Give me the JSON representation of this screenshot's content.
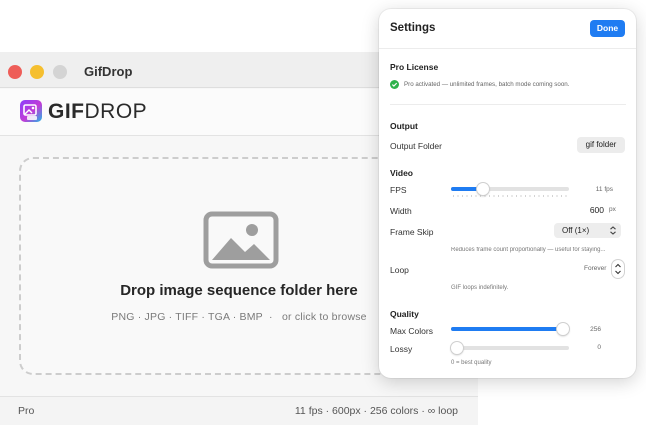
{
  "window": {
    "title": "GifDrop"
  },
  "logo": {
    "text_bold": "GIF",
    "text_light": "DROP"
  },
  "drop_zone": {
    "title": "Drop image sequence folder here",
    "formats": "PNG · JPG · TIFF · TGA · BMP",
    "browse_hint": "or click to browse"
  },
  "status": {
    "left": "Pro",
    "right": "11 fps · 600px · 256 colors · ∞ loop"
  },
  "settings": {
    "title": "Settings",
    "done_label": "Done",
    "license": {
      "heading": "Pro License",
      "status_text": "Pro activated — unlimited frames, batch mode coming soon."
    },
    "output": {
      "heading": "Output",
      "folder_label": "Output Folder",
      "folder_button": "gif folder"
    },
    "video": {
      "heading": "Video",
      "fps_label": "FPS",
      "fps_value": "11 fps",
      "fps_fraction": 0.27,
      "width_label": "Width",
      "width_value": "600",
      "width_unit": "px",
      "frame_skip_label": "Frame Skip",
      "frame_skip_value": "Off (1×)",
      "frame_skip_note": "Reduces frame count proportionally — useful for staying...",
      "loop_label": "Loop",
      "loop_value": "Forever",
      "loop_note": "GIF loops indefinitely."
    },
    "quality": {
      "heading": "Quality",
      "max_colors_label": "Max Colors",
      "max_colors_value": "256",
      "max_colors_fraction": 0.97,
      "lossy_label": "Lossy",
      "lossy_value": "0",
      "lossy_fraction": 0.0,
      "lossy_note": "0 = best quality"
    }
  },
  "colors": {
    "accent": "#1f7cf2",
    "success": "#2fb24c"
  }
}
